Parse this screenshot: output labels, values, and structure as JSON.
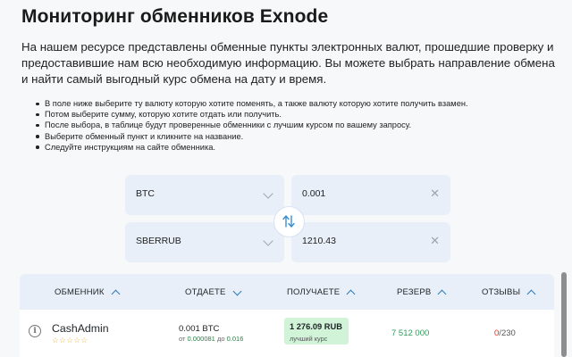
{
  "page": {
    "title": "Мониторинг обменников Exnode",
    "intro": "На нашем ресурсе представлены обменные пункты электронных валют, прошедшие проверку и предоставившие нам всю необходимую информацию. Вы можете выбрать направление обмена и найти самый выгодный курс обмена на дату и время.",
    "steps": [
      "В поле ниже выберите ту валюту которую хотите поменять, а также валюту которую хотите получить взамен.",
      "Потом выберите сумму, которую хотите отдать или получить.",
      "После выбора, в таблице будут проверенные обменники с лучшим курсом по вашему запросу.",
      "Выберите обменный пункт и кликните на название.",
      "Следуйте инструкциям на сайте обменника."
    ]
  },
  "form": {
    "from_currency": "BTC",
    "from_amount": "0.001",
    "to_currency": "SBERRUB",
    "to_amount": "1210.43",
    "icons": {
      "select": "chevron-down-icon",
      "clear": "close-icon",
      "swap": "swap-arrows-icon"
    }
  },
  "table": {
    "headers": {
      "exchanger": "ОБМЕННИК",
      "give": "ОТДАЕТЕ",
      "get": "ПОЛУЧАЕТЕ",
      "reserve": "РЕЗЕРВ",
      "reviews": "ОТЗЫВЫ"
    },
    "rows": [
      {
        "name": "CashAdmin",
        "stars": "☆☆☆☆☆",
        "give_amount": "0.001 BTC",
        "range_from_label": "от",
        "range_from": "0.000081",
        "range_to_label": "до",
        "range_to": "0.016",
        "get_amount": "1 276.09 RUB",
        "get_label": "лучший курс",
        "reserve": "7 512 000",
        "reviews_negative": "0",
        "reviews_sep": "/",
        "reviews_total": "230"
      }
    ]
  },
  "colors": {
    "accent": "#2b7bbb",
    "field_bg": "#e9eff8",
    "best_rate_bg": "#d1f3d7",
    "reserve": "#2e9a5b",
    "negative": "#d93025",
    "stars": "#e8b33a"
  }
}
